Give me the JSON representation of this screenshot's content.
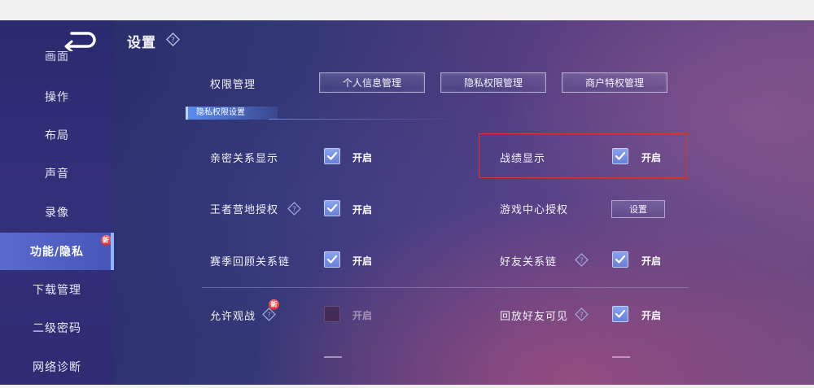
{
  "sidebar": {
    "partial_item": "画面",
    "items": [
      {
        "label": "操作"
      },
      {
        "label": "布局"
      },
      {
        "label": "声音"
      },
      {
        "label": "录像"
      },
      {
        "label": "功能/隐私",
        "badge": "新"
      },
      {
        "label": "下载管理"
      },
      {
        "label": "二级密码"
      },
      {
        "label": "网络诊断"
      }
    ]
  },
  "header": {
    "title": "设置",
    "help_icon": "question-diamond-icon"
  },
  "permissions": {
    "label": "权限管理",
    "buttons": [
      "个人信息管理",
      "隐私权限管理",
      "商户特权管理"
    ]
  },
  "privacy_section": {
    "title": "隐私权限设置",
    "on_text": "开启",
    "rows": [
      {
        "left": {
          "label": "亲密关系显示",
          "checked": true
        },
        "right": {
          "label": "战绩显示",
          "checked": true,
          "highlighted": true
        }
      },
      {
        "left": {
          "label": "王者营地授权",
          "checked": true,
          "help": true
        },
        "right": {
          "label": "游戏中心授权",
          "button": "设置"
        }
      },
      {
        "left": {
          "label": "赛季回顾关系链",
          "checked": true
        },
        "right": {
          "label": "好友关系链",
          "checked": true,
          "help": true
        }
      },
      {
        "left": {
          "label": "允许观战",
          "checked": false,
          "help": true,
          "badge": "新"
        },
        "right": {
          "label": "回放好友可见",
          "checked": true,
          "help": true
        }
      }
    ]
  },
  "colors": {
    "accent": "#5b6acd",
    "checkbox": "#7a93e6",
    "highlight": "#e33030"
  }
}
